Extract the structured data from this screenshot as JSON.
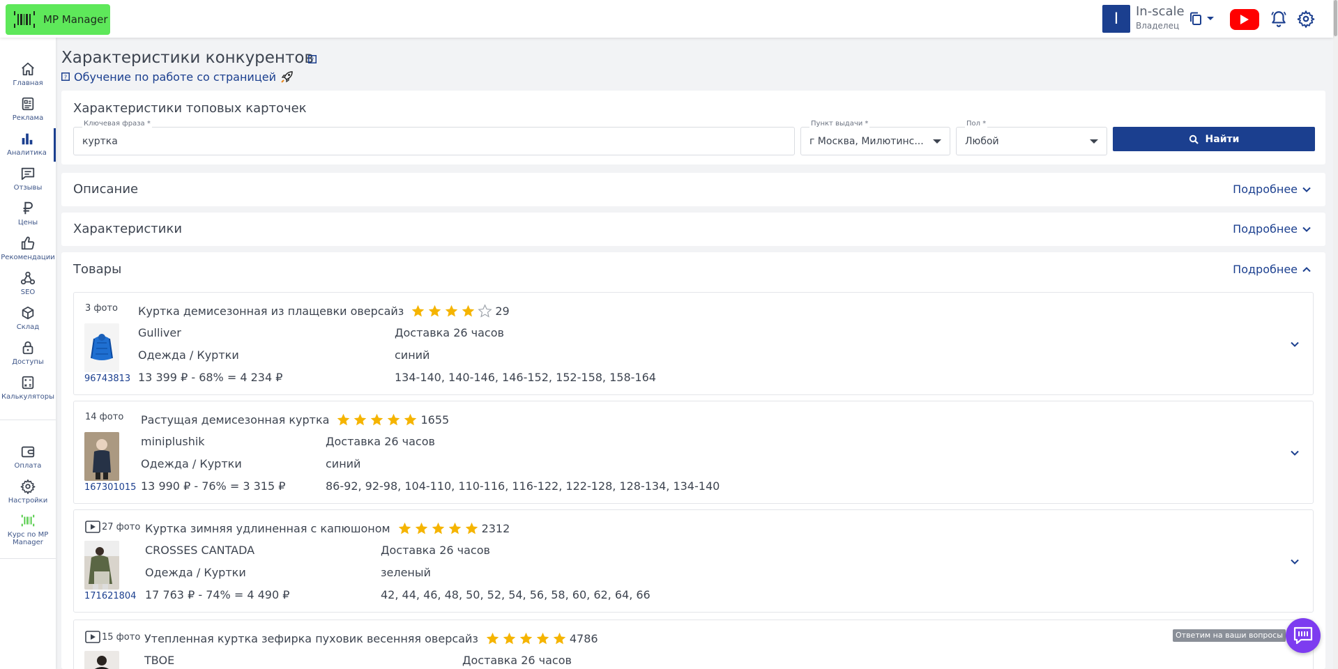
{
  "header": {
    "logo_text": "MP Manager",
    "user_initial": "I",
    "user_name": "In-scale",
    "user_role": "Владелец",
    "youtube_color": "#ff0000",
    "brand_color": "#1b3f8f",
    "logo_color": "#5ee85a"
  },
  "sidebar": {
    "items": [
      {
        "label": "Главная",
        "icon": "home-icon"
      },
      {
        "label": "Реклама",
        "icon": "ads-icon"
      },
      {
        "label": "Аналитика",
        "icon": "bar-chart-icon",
        "active": true
      },
      {
        "label": "Отзывы",
        "icon": "reviews-icon"
      },
      {
        "label": "Цены",
        "icon": "ruble-icon"
      },
      {
        "label": "Рекомендации",
        "icon": "thumbs-up-icon"
      },
      {
        "label": "SEO",
        "icon": "webhook-icon"
      },
      {
        "label": "Склад",
        "icon": "box-icon"
      },
      {
        "label": "Доступы",
        "icon": "lock-icon"
      },
      {
        "label": "Калькуляторы",
        "icon": "calculator-icon"
      }
    ],
    "bottom_items": [
      {
        "label": "Оплата",
        "icon": "wallet-icon"
      },
      {
        "label": "Настройки",
        "icon": "gear-icon"
      },
      {
        "label": "Курс по MP Manager",
        "icon": "barcode-icon"
      }
    ]
  },
  "page": {
    "title": "Характеристики конкурентов",
    "guide_link": "Обучение по работе со страницей"
  },
  "search_card": {
    "title": "Характеристики топовых карточек",
    "keyword_label": "Ключевая фраза *",
    "keyword_value": "куртка",
    "pickup_label": "Пункт выдачи *",
    "pickup_value": "г Москва, Милютинс...",
    "gender_label": "Пол *",
    "gender_value": "Любой",
    "search_button": "Найти"
  },
  "sections": {
    "description_title": "Описание",
    "characteristics_title": "Характеристики",
    "products_title": "Товары",
    "more_label": "Подробнее"
  },
  "products": [
    {
      "photos": "3 фото",
      "has_video": false,
      "name": "Куртка демисезонная из плащевки оверсайз",
      "rating_stars": 4,
      "reviews": "29",
      "brand": "Gulliver",
      "category": "Одежда / Куртки",
      "price": "13 399 ₽ - 68% = 4 234 ₽",
      "delivery": "Доставка 26 часов",
      "color": "синий",
      "sizes": "134-140, 140-146, 146-152, 152-158, 158-164",
      "id": "96743813"
    },
    {
      "photos": "14 фото",
      "has_video": false,
      "name": "Растущая демисезонная куртка",
      "rating_stars": 5,
      "reviews": "1655",
      "brand": "miniplushik",
      "category": "Одежда / Куртки",
      "price": "13 990 ₽ - 76% = 3 315 ₽",
      "delivery": "Доставка 26 часов",
      "color": "синий",
      "sizes": "86-92, 92-98, 104-110, 110-116, 116-122, 122-128, 128-134, 134-140",
      "id": "167301015"
    },
    {
      "photos": "27 фото",
      "has_video": true,
      "name": "Куртка зимняя удлиненная с капюшоном",
      "rating_stars": 5,
      "reviews": "2312",
      "brand": "CROSSES CANTADA",
      "category": "Одежда / Куртки",
      "price": "17 763 ₽ - 74% = 4 490 ₽",
      "delivery": "Доставка 26 часов",
      "color": "зеленый",
      "sizes": "42, 44, 46, 48, 50, 52, 54, 56, 58, 60, 62, 64, 66",
      "id": "171621804"
    },
    {
      "photos": "15 фото",
      "has_video": true,
      "name": "Утепленная куртка зефирка пуховик весенняя оверсайз",
      "rating_stars": 5,
      "reviews": "4786",
      "brand": "TBOE",
      "delivery": "Доставка 26 часов"
    }
  ],
  "chat": {
    "tooltip": "Ответим на ваши вопросы"
  }
}
